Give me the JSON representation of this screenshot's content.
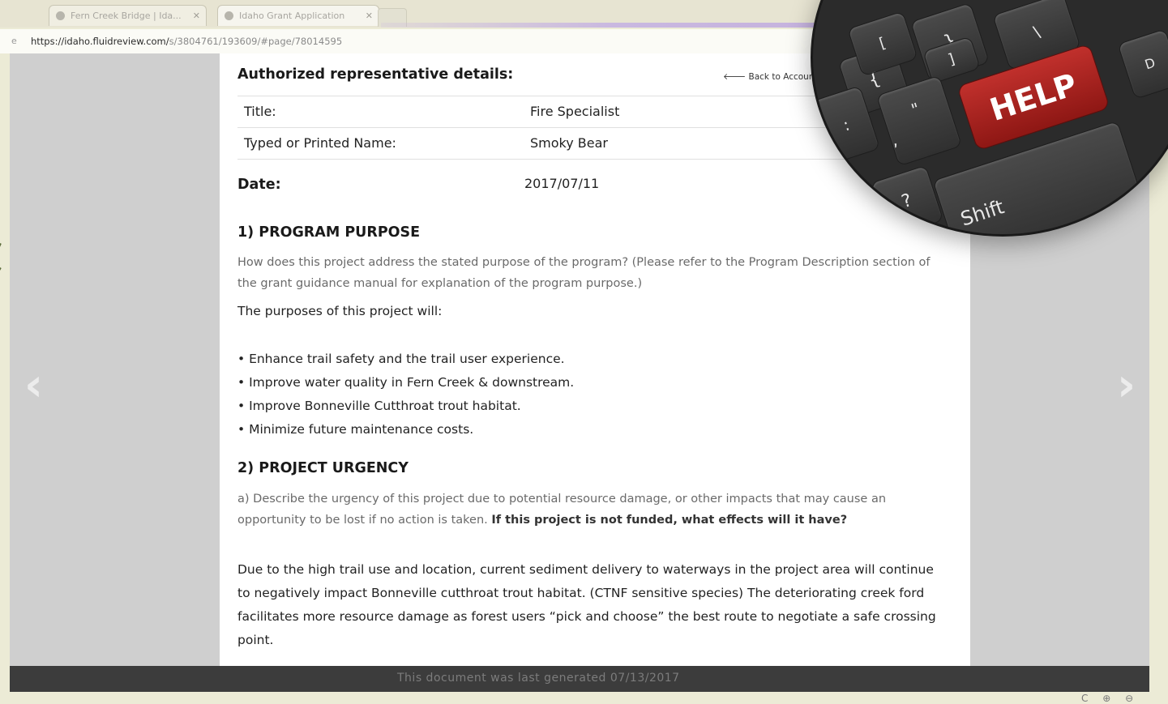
{
  "browser": {
    "tabs": [
      {
        "label": "Fern Creek Bridge | Ida..."
      },
      {
        "label": "Idaho Grant Application"
      }
    ],
    "url_lead": "e",
    "url_host": "https://idaho.fluidreview.com/",
    "url_path": "s/3804761/193609/#page/78014595"
  },
  "form": {
    "heading": "Authorized representative details:",
    "back_link": "Back to Account",
    "rows": [
      {
        "label": "Title:",
        "value": "Fire Specialist"
      },
      {
        "label": "Typed or Printed Name:",
        "value": "Smoky Bear"
      }
    ],
    "date_label": "Date:",
    "date_value": "2017/07/11"
  },
  "section1": {
    "heading": "1) PROGRAM PURPOSE",
    "prompt": "How does this project address the stated purpose of the program? (Please refer to the Program Description section of the grant guidance manual for explanation of the program purpose.)",
    "intro": "The purposes of this project will:",
    "bullets": [
      "• Enhance trail safety and the trail user experience.",
      "• Improve water quality in Fern Creek & downstream.",
      "• Improve Bonneville Cutthroat trout habitat.",
      "• Minimize future maintenance costs."
    ]
  },
  "section2": {
    "heading": "2) PROJECT URGENCY",
    "prompt_plain": "a) Describe the urgency of this project due to potential resource damage, or other impacts that may cause an opportunity to be lost if no action is taken. ",
    "prompt_bold": "If this project is not funded, what effects will it have?",
    "answer": "Due to the high trail use and location, current sediment delivery to waterways in the project area will continue to negatively impact Bonneville cutthroat trout habitat. (CTNF sensitive species) The deteriorating creek ford facilitates more resource damage as forest users “pick and choose” the best route to negotiate a safe crossing point."
  },
  "viewer": {
    "prev_arrow": "‹",
    "next_arrow": "›",
    "footer_text": "This document was last generated 07/13/2017"
  },
  "status_icons": "C ⊕ ⊖",
  "help_badge": {
    "help_label": "HELP",
    "shift_label": "Shift",
    "keys": [
      "{",
      "[",
      "}",
      "]",
      "\\",
      ":",
      "\"",
      ",",
      "?",
      "D"
    ]
  }
}
